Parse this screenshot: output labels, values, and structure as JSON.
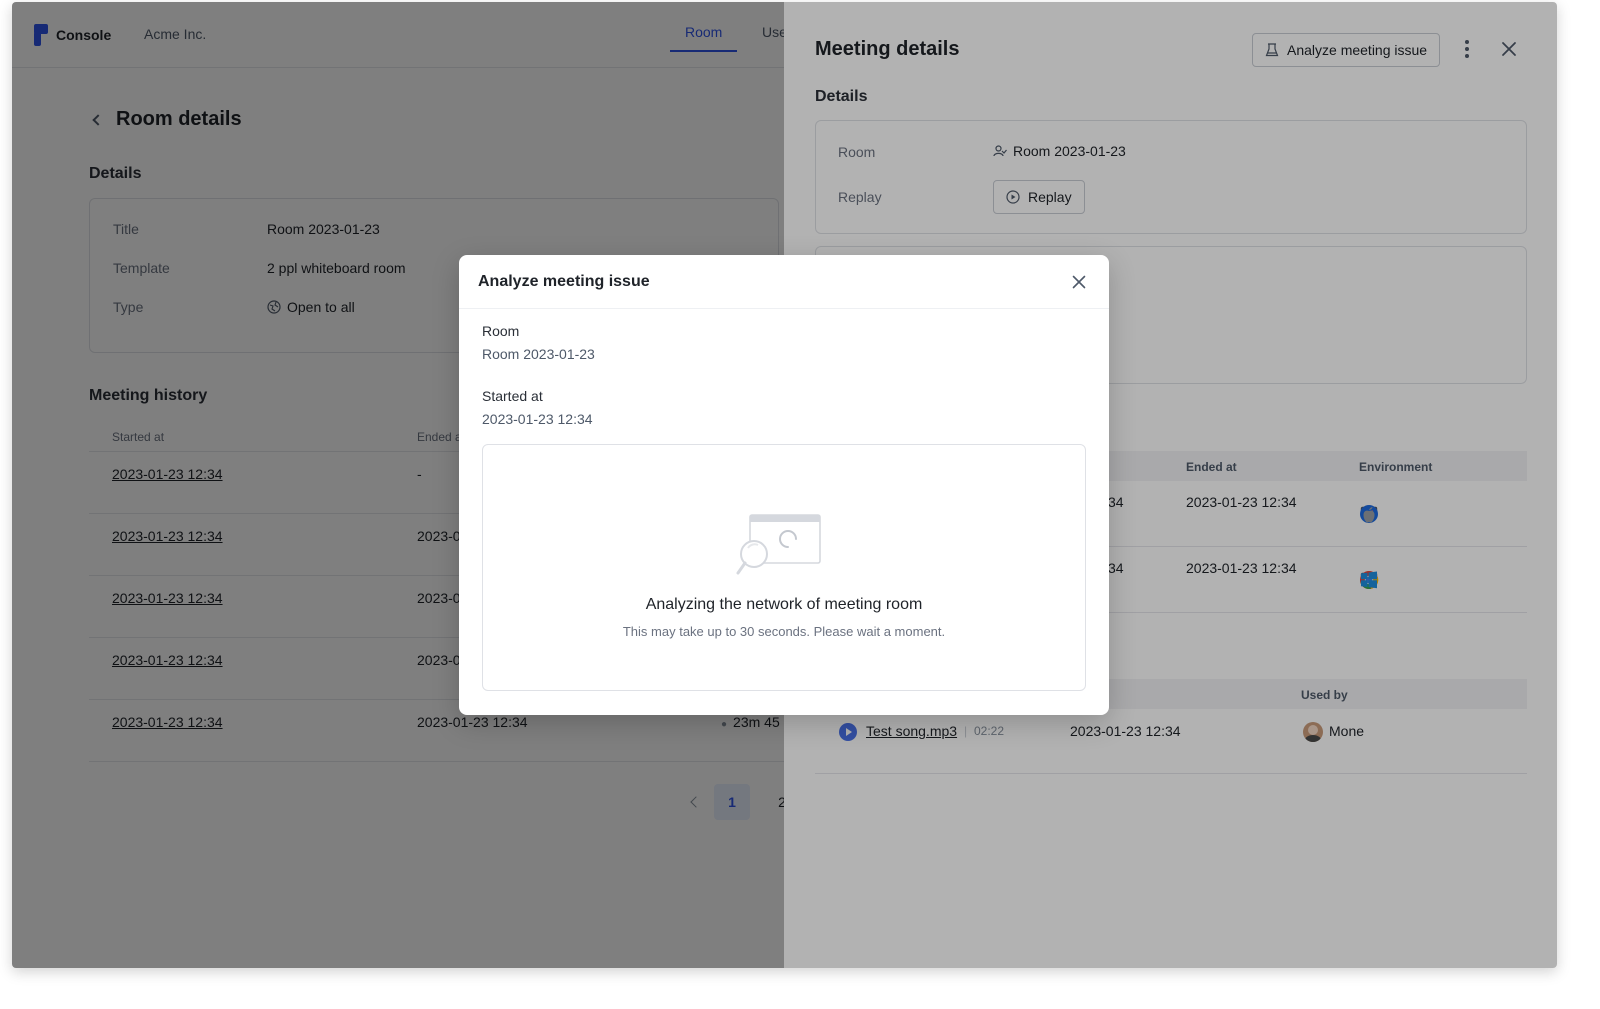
{
  "topbar": {
    "brand": "Console",
    "org": "Acme Inc.",
    "tabs": [
      {
        "label": "Room"
      },
      {
        "label": "Use"
      }
    ]
  },
  "room_page": {
    "title": "Room details",
    "details_heading": "Details",
    "details": {
      "title_label": "Title",
      "title_value": "Room 2023-01-23",
      "template_label": "Template",
      "template_value": "2 ppl whiteboard room",
      "type_label": "Type",
      "type_value": "Open to all"
    },
    "history_heading": "Meeting history",
    "history_columns": {
      "started": "Started at",
      "ended": "Ended a"
    },
    "history_rows": [
      {
        "started": "2023-01-23 12:34",
        "ended": "-",
        "extra": ""
      },
      {
        "started": "2023-01-23 12:34",
        "ended": "2023-0",
        "extra": ""
      },
      {
        "started": "2023-01-23 12:34",
        "ended": "2023-0",
        "extra": ""
      },
      {
        "started": "2023-01-23 12:34",
        "ended": "2023-0",
        "extra": ""
      },
      {
        "started": "2023-01-23 12:34",
        "ended": "2023-01-23 12:34",
        "extra": "23m 45"
      }
    ],
    "pagination": {
      "current": "1",
      "next": "2"
    }
  },
  "drawer": {
    "title": "Meeting details",
    "analyze_button": "Analyze meeting issue",
    "details_heading": "Details",
    "room_label": "Room",
    "room_value": "Room 2023-01-23",
    "replay_label": "Replay",
    "replay_button": "Replay",
    "participants": {
      "columns": {
        "ended": "Ended at",
        "environment": "Environment"
      },
      "rows": [
        {
          "partial_started": "34",
          "ended": "2023-01-23 12:34",
          "env": [
            "desktop-icon",
            "safari-icon",
            "apple-icon"
          ]
        },
        {
          "partial_started": "34",
          "ended": "2023-01-23 12:34",
          "env": [
            "desktop-icon",
            "chrome-icon",
            "windows-icon"
          ]
        }
      ]
    },
    "recordings": {
      "columns": {
        "used_by": "Used by"
      },
      "rows": [
        {
          "file": "Test song.mp3",
          "duration": "02:22",
          "date": "2023-01-23 12:34",
          "user": "Mone"
        }
      ]
    }
  },
  "modal": {
    "title": "Analyze meeting issue",
    "room_label": "Room",
    "room_value": "Room 2023-01-23",
    "started_label": "Started at",
    "started_value": "2023-01-23 12:34",
    "status_title": "Analyzing the network of meeting room",
    "status_subtitle": "This may take up to 30 seconds. Please wait a moment."
  },
  "colors": {
    "accent": "#2f54eb",
    "overlay": "rgba(0,0,0,0.5)"
  }
}
